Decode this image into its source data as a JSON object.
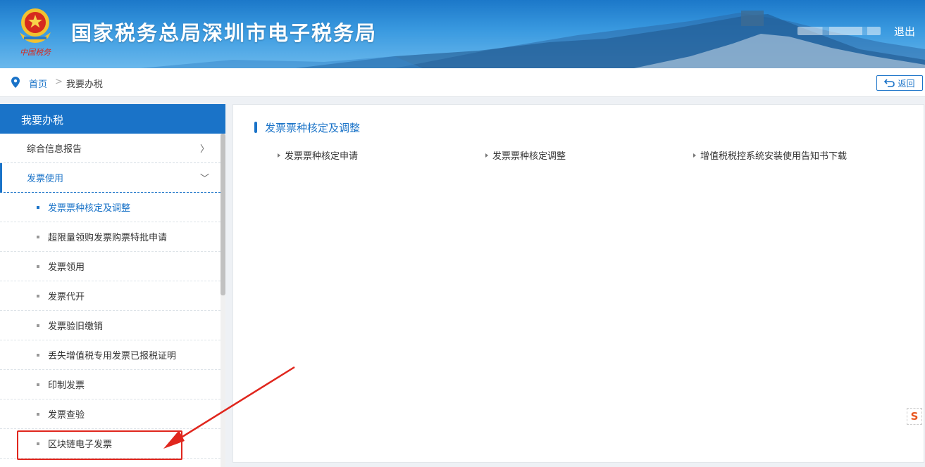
{
  "header": {
    "title": "国家税务总局深圳市电子税务局",
    "logout_label": "退出",
    "emblem_text": "中国税务"
  },
  "breadcrumb": {
    "home": "首页",
    "separator": ">",
    "current": "我要办税",
    "back_label": "返回"
  },
  "sidebar": {
    "heading": "我要办税",
    "groups": [
      {
        "label": "综合信息报告",
        "chevron": "〉",
        "expanded": false
      },
      {
        "label": "发票使用",
        "chevron": "﹀",
        "expanded": true
      }
    ],
    "sub_items": [
      {
        "label": "发票票种核定及调整",
        "active": true
      },
      {
        "label": "超限量领购发票购票特批申请",
        "active": false
      },
      {
        "label": "发票领用",
        "active": false
      },
      {
        "label": "发票代开",
        "active": false
      },
      {
        "label": "发票验旧缴销",
        "active": false
      },
      {
        "label": "丢失增值税专用发票已报税证明",
        "active": false
      },
      {
        "label": "印制发票",
        "active": false
      },
      {
        "label": "发票查验",
        "active": false
      },
      {
        "label": "区块链电子发票",
        "active": false
      }
    ]
  },
  "main": {
    "section_title": "发票票种核定及调整",
    "links": [
      "发票票种核定申请",
      "发票票种核定调整",
      "增值税税控系统安装使用告知书下载"
    ]
  },
  "badge": {
    "label": "S"
  },
  "colors": {
    "accent": "#1a73c8",
    "annotation": "#e0261d",
    "header_top": "#1c78c9"
  }
}
